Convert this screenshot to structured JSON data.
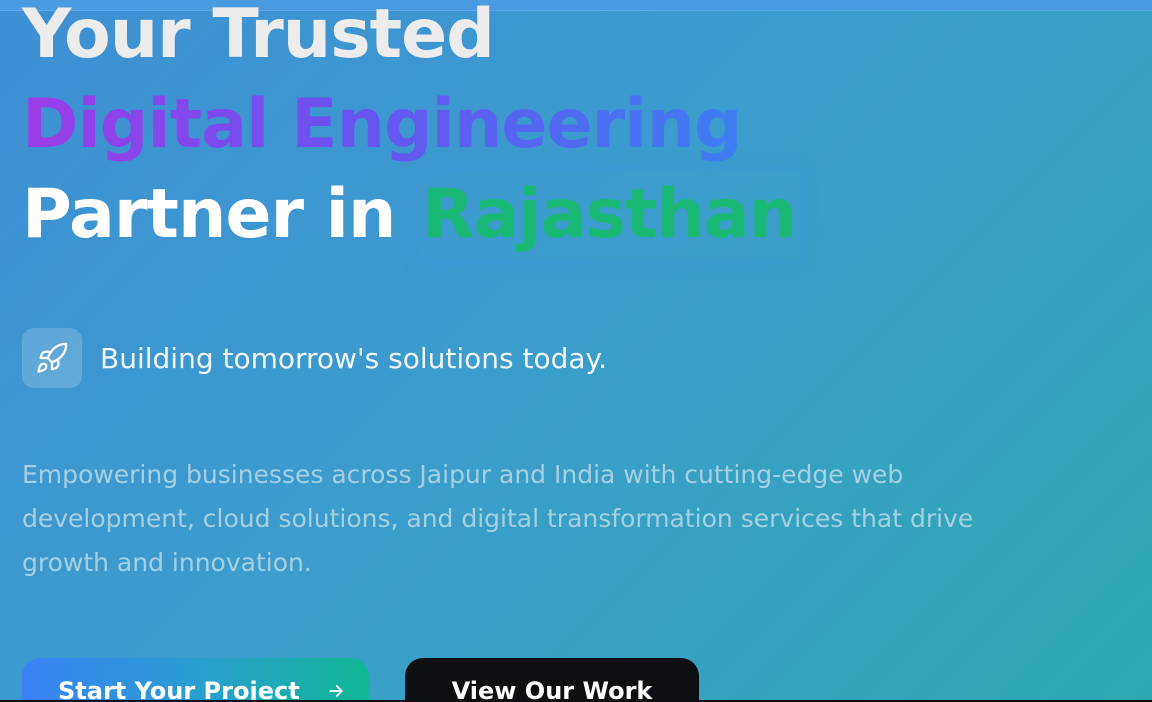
{
  "hero": {
    "headline_line1": "Your Trusted",
    "headline_line2": "Digital Engineering",
    "headline_line3_prefix": "Partner in ",
    "headline_line3_highlight": "Rajasthan",
    "tagline": "Building tomorrow's solutions today.",
    "tagline_icon": "rocket-icon",
    "description": "Empowering businesses across Jaipur and India with cutting-edge web development, cloud solutions, and digital transformation services that drive growth and innovation."
  },
  "buttons": {
    "primary_label": "Start Your Project",
    "primary_icon": "arrow-right-icon",
    "secondary_label": "View Our Work"
  },
  "colors": {
    "background_start": "#3e8fd4",
    "background_end": "#2da8b2",
    "gradient_text_start": "#9b3ee8",
    "gradient_text_end": "#3e7ef2",
    "highlight_green": "#19b874",
    "secondary_button": "#0d0f12"
  }
}
